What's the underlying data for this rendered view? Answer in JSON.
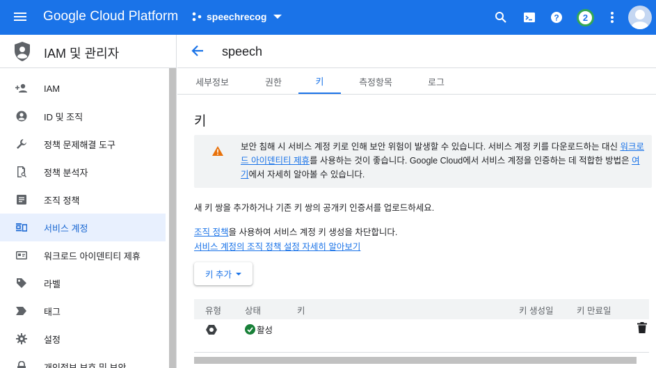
{
  "topbar": {
    "brand": "Google Cloud Platform",
    "project": "speechrecog",
    "notification_count": "2",
    "icons": [
      "menu-icon",
      "search-icon",
      "terminal-icon",
      "help-icon",
      "more-vert-icon",
      "account-avatar"
    ],
    "color": "#1a73e8"
  },
  "sidebar": {
    "title": "IAM 및 관리자",
    "items": [
      {
        "label": "IAM",
        "icon": "person-add-icon"
      },
      {
        "label": "ID 및 조직",
        "icon": "account-circle-icon"
      },
      {
        "label": "정책 문제해결 도구",
        "icon": "wrench-icon"
      },
      {
        "label": "정책 분석자",
        "icon": "document-search-icon"
      },
      {
        "label": "조직 정책",
        "icon": "list-doc-icon"
      },
      {
        "label": "서비스 계정",
        "icon": "service-account-icon",
        "active": true
      },
      {
        "label": "워크로드 아이덴티티 제휴",
        "icon": "id-card-icon"
      },
      {
        "label": "라벨",
        "icon": "label-icon"
      },
      {
        "label": "태그",
        "icon": "tag-arrow-icon"
      },
      {
        "label": "설정",
        "icon": "gear-icon"
      },
      {
        "label": "개인정보 보호 및 보안",
        "icon": "lock-icon"
      }
    ]
  },
  "main": {
    "title": "speech",
    "tabs": [
      {
        "label": "세부정보"
      },
      {
        "label": "권한"
      },
      {
        "label": "키",
        "active": true
      },
      {
        "label": "측정항목"
      },
      {
        "label": "로그"
      }
    ],
    "section_title": "키",
    "alert": {
      "text_1": "보안 침해 시 서비스 계정 키로 인해 보안 위험이 발생할 수 있습니다. 서비스 계정 키를 다운로드하는 대신 ",
      "link_1": "워크로드 아이덴티티 제휴",
      "text_2": "를 사용하는 것이 좋습니다. Google Cloud에서 서비스 계정을 인증하는 데 적합한 방법은 ",
      "link_2": "여기",
      "text_3": "에서 자세히 알아볼 수 있습니다."
    },
    "intro": "새 키 쌍을 추가하거나 기존 키 쌍의 공개키 인증서를 업로드하세요.",
    "policy_link": "조직 정책",
    "policy_text": "을 사용하여 서비스 계정 키 생성을 차단합니다.",
    "policy_learn_link": "서비스 계정의 조직 정책 설정 자세히 알아보기",
    "add_key_label": "키 추가",
    "table": {
      "headers": [
        "유형",
        "상태",
        "키",
        "키 생성일",
        "키 만료일"
      ],
      "rows": [
        {
          "type_icon": "hexagon-key-icon",
          "status": "활성",
          "key": "",
          "created": "",
          "expires": ""
        }
      ]
    }
  }
}
